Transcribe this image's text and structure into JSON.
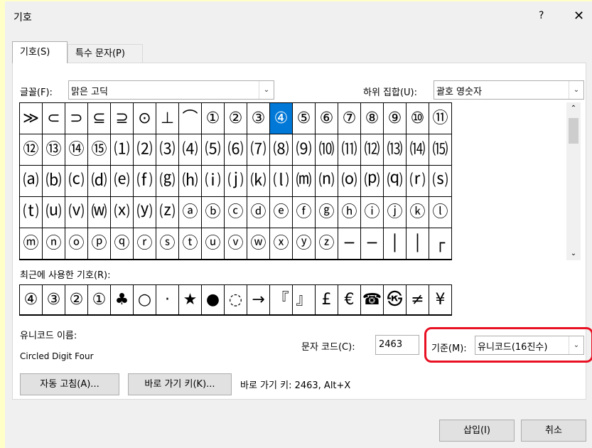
{
  "dialog": {
    "title": "기호",
    "help": "?",
    "close": "✕"
  },
  "tabs": [
    {
      "label": "기호(S)"
    },
    {
      "label": "특수 문자(P)"
    }
  ],
  "font": {
    "label": "글꼴(F):",
    "value": "맑은 고딕"
  },
  "subset": {
    "label": "하위 집합(U):",
    "value": "괄호 영숫자"
  },
  "symbol_grid": [
    [
      "≫",
      "⊂",
      "⊃",
      "⊆",
      "⊇",
      "⊙",
      "⊥",
      "⌒",
      "①",
      "②",
      "③",
      "④",
      "⑤",
      "⑥",
      "⑦",
      "⑧",
      "⑨",
      "⑩",
      "⑪"
    ],
    [
      "⑫",
      "⑬",
      "⑭",
      "⑮",
      "⑴",
      "⑵",
      "⑶",
      "⑷",
      "⑸",
      "⑹",
      "⑺",
      "⑻",
      "⑼",
      "⑽",
      "⑾",
      "⑿",
      "⒀",
      "⒁",
      "⒂"
    ],
    [
      "⒜",
      "⒝",
      "⒞",
      "⒟",
      "⒠",
      "⒡",
      "⒢",
      "⒣",
      "⒤",
      "⒥",
      "⒦",
      "⒧",
      "⒨",
      "⒩",
      "⒪",
      "⒫",
      "⒬",
      "⒭",
      "⒮"
    ],
    [
      "⒯",
      "⒰",
      "⒱",
      "⒲",
      "⒳",
      "⒴",
      "⒵",
      "ⓐ",
      "ⓑ",
      "ⓒ",
      "ⓓ",
      "ⓔ",
      "ⓕ",
      "ⓖ",
      "ⓗ",
      "ⓘ",
      "ⓙ",
      "ⓚ",
      "ⓛ"
    ],
    [
      "ⓜ",
      "ⓝ",
      "ⓞ",
      "ⓟ",
      "ⓠ",
      "ⓡ",
      "ⓢ",
      "ⓣ",
      "ⓤ",
      "ⓥ",
      "ⓦ",
      "ⓧ",
      "ⓨ",
      "ⓩ",
      "─",
      "─",
      "│",
      "│",
      "┌"
    ]
  ],
  "selected_symbol": "④",
  "recent": {
    "label": "최근에 사용한 기호(R):",
    "symbols": [
      "④",
      "③",
      "②",
      "①",
      "♣",
      "○",
      "·",
      "★",
      "●",
      "◌",
      "→",
      "『",
      "』",
      "£",
      "€",
      "☎",
      "㉿",
      "≠",
      "¥"
    ]
  },
  "unicode_name": {
    "label": "유니코드 이름:",
    "value": "Circled Digit Four"
  },
  "char_code": {
    "label": "문자 코드(C):",
    "value": "2463"
  },
  "basis": {
    "label": "기준(M):",
    "value": "유니코드(16진수)"
  },
  "buttons": {
    "autocorrect": "자동 고침(A)...",
    "shortcut_key": "바로 가기 키(K)...",
    "insert": "삽입(I)",
    "cancel": "취소"
  },
  "shortcut_text": "바로 가기 키: 2463, Alt+X",
  "colors": {
    "selection": "#0078d7",
    "highlight_border": "#e81123",
    "left_strip": "#ffffc8"
  }
}
